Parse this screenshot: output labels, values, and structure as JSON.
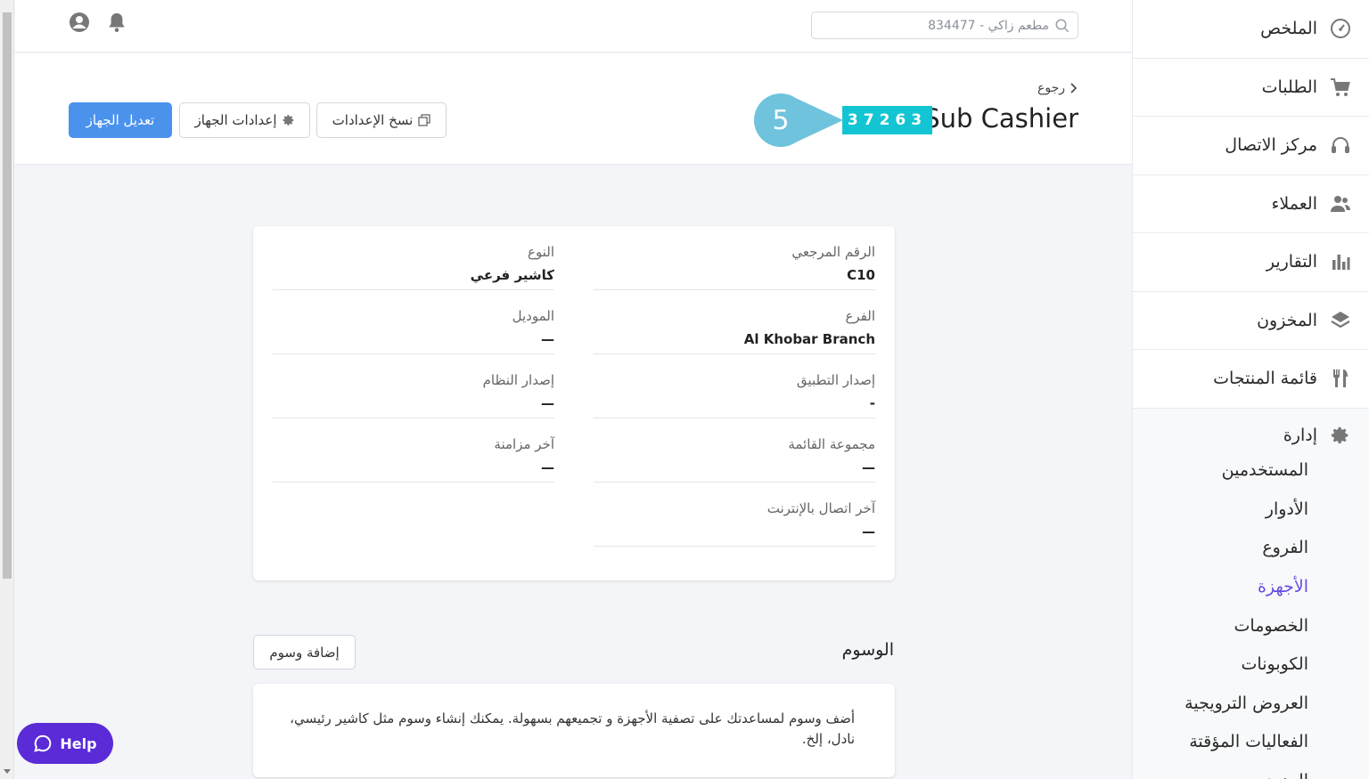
{
  "colors": {
    "accent": "#6a4ce0",
    "primary_button": "#4b92ed",
    "badge": "#13c5d3",
    "step_marker": "#6fc3dc",
    "help": "#5a2bd6"
  },
  "sidebar": {
    "items": [
      {
        "label": "الملخص",
        "icon": "dashboard-gauge-icon"
      },
      {
        "label": "الطلبات",
        "icon": "cart-icon"
      },
      {
        "label": "مركز الاتصال",
        "icon": "headset-icon"
      },
      {
        "label": "العملاء",
        "icon": "users-icon"
      },
      {
        "label": "التقارير",
        "icon": "bar-chart-icon"
      },
      {
        "label": "المخزون",
        "icon": "layers-icon"
      },
      {
        "label": "قائمة المنتجات",
        "icon": "fork-knife-icon"
      }
    ],
    "admin": {
      "label": "إدارة",
      "icon": "gear-icon",
      "items": [
        "المستخدمين",
        "الأدوار",
        "الفروع",
        "الأجهزة",
        "الخصومات",
        "الكوبونات",
        "العروض الترويجية",
        "الفعاليات المؤقتة",
        "المزيد"
      ],
      "active": "الأجهزة"
    }
  },
  "topbar": {
    "search_placeholder": "مطعم زاكي - 834477"
  },
  "header": {
    "back": "رجوع",
    "title": "Sub Cashier",
    "device_code": "37263",
    "step_number": "5",
    "copy_settings": "نسخ الإعدادات",
    "device_settings": "إعدادات الجهاز",
    "edit_device": "تعديل الجهاز"
  },
  "details": {
    "reference": {
      "label": "الرقم المرجعي",
      "value": "C10"
    },
    "type": {
      "label": "النوع",
      "value": "كاشير فرعي"
    },
    "branch": {
      "label": "الفرع",
      "value": "Al Khobar Branch"
    },
    "model": {
      "label": "الموديل",
      "value": "—"
    },
    "app_version": {
      "label": "إصدار التطبيق",
      "value": "-"
    },
    "system_version": {
      "label": "إصدار النظام",
      "value": "—"
    },
    "menu_group": {
      "label": "مجموعة القائمة",
      "value": "—"
    },
    "last_sync": {
      "label": "آخر مزامنة",
      "value": "—"
    },
    "last_online": {
      "label": "آخر اتصال بالإنترنت",
      "value": "—"
    }
  },
  "tags": {
    "title": "الوسوم",
    "add_button": "إضافة وسوم",
    "description": "أضف وسوم لمساعدتك على تصفية الأجهزة و تجميعهم بسهولة. يمكنك إنشاء وسوم مثل كاشير رئيسي، نادل، إلخ."
  },
  "help": {
    "label": "Help"
  }
}
